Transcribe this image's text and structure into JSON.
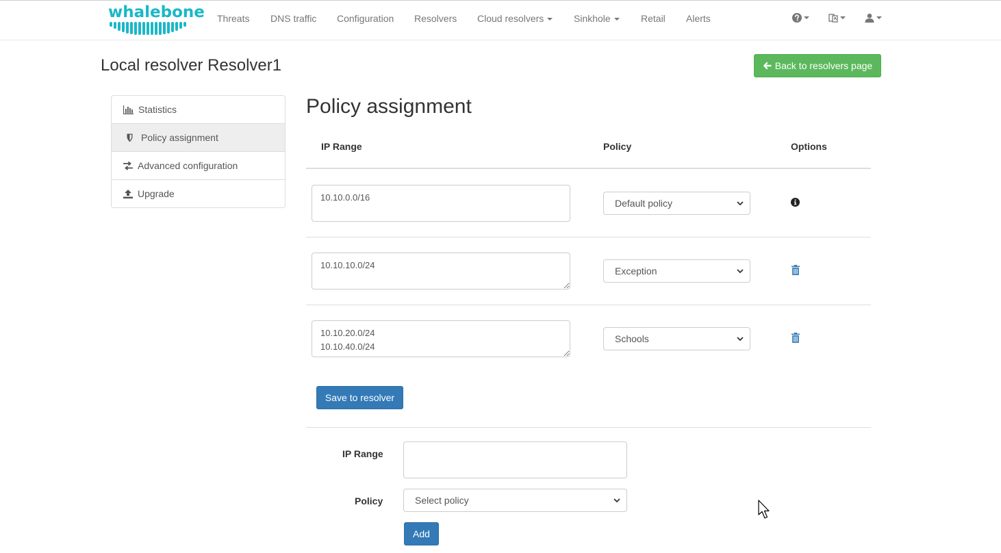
{
  "brand": {
    "name": "whalebone",
    "color": "#19b8c7"
  },
  "nav": {
    "items": [
      {
        "label": "Threats"
      },
      {
        "label": "DNS traffic"
      },
      {
        "label": "Configuration"
      },
      {
        "label": "Resolvers"
      },
      {
        "label": "Cloud resolvers",
        "dropdown": true
      },
      {
        "label": "Sinkhole",
        "dropdown": true
      },
      {
        "label": "Retail"
      },
      {
        "label": "Alerts"
      }
    ],
    "right_icons": [
      "help-icon",
      "language-icon",
      "user-icon"
    ]
  },
  "page": {
    "title": "Local resolver Resolver1",
    "back_button": "Back to resolvers page"
  },
  "sidebar": {
    "items": [
      {
        "label": "Statistics",
        "icon": "bar-chart-icon",
        "active": false
      },
      {
        "label": "Policy assignment",
        "icon": "shield-icon",
        "active": true
      },
      {
        "label": "Advanced configuration",
        "icon": "transfer-icon",
        "active": false
      },
      {
        "label": "Upgrade",
        "icon": "upload-icon",
        "active": false
      }
    ]
  },
  "policy": {
    "title": "Policy assignment",
    "columns": [
      "IP Range",
      "Policy",
      "Options"
    ],
    "rows": [
      {
        "ip_range": "10.10.0.0/16",
        "policy": "Default policy",
        "option_icon": "info-icon"
      },
      {
        "ip_range": "10.10.10.0/24",
        "policy": "Exception",
        "option_icon": "trash-icon"
      },
      {
        "ip_range": "10.10.20.0/24\n10.10.40.0/24",
        "policy": "Schools",
        "option_icon": "trash-icon"
      }
    ],
    "save_button": "Save to resolver"
  },
  "add_form": {
    "ip_label": "IP Range",
    "ip_value": "",
    "policy_label": "Policy",
    "policy_placeholder": "Select policy",
    "add_button": "Add"
  },
  "colors": {
    "success": "#5cb85c",
    "primary": "#337ab7",
    "link_icon": "#337ab7"
  }
}
